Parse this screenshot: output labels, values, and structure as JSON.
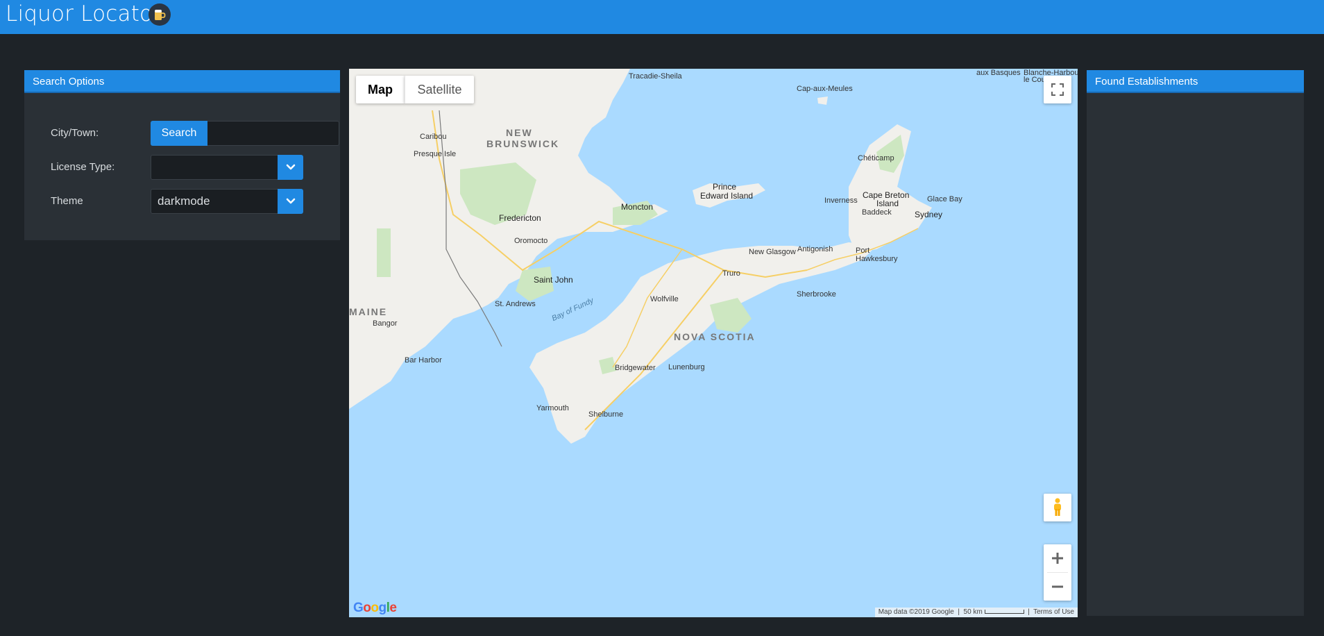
{
  "app": {
    "title": "Liquor Locator",
    "logo_icon": "beer-mug-icon",
    "accent_color": "#2089e2",
    "background_color": "#1e2328"
  },
  "search_options": {
    "header": "Search Options",
    "city_label": "City/Town:",
    "search_button": "Search",
    "city_value": "",
    "license_label": "License Type:",
    "license_value": "",
    "theme_label": "Theme",
    "theme_value": "darkmode"
  },
  "found": {
    "header": "Found Establishments",
    "items": []
  },
  "map": {
    "type_map": "Map",
    "type_satellite": "Satellite",
    "attribution_data": "Map data ©2019 Google",
    "scale": "50 km",
    "terms": "Terms of Use",
    "logo": "Google",
    "labels": {
      "new_brunswick": "NEW",
      "new_brunswick2": "BRUNSWICK",
      "nova_scotia": "NOVA SCOTIA",
      "maine": "MAINE",
      "pei": "Prince",
      "pei2": "Edward Island",
      "cape_breton": "Cape Breton",
      "cape_breton2": "Island",
      "fredericton": "Fredericton",
      "moncton": "Moncton",
      "saint_john": "Saint John",
      "sydney": "Sydney",
      "truro": "Truro",
      "antigonish": "Antigonish",
      "new_glasgow": "New Glasgow",
      "yarmouth": "Yarmouth",
      "bridgewater": "Bridgewater",
      "lunenburg": "Lunenburg",
      "shelburne": "Shelburne",
      "wolfville": "Wolfville",
      "sherbrooke": "Sherbrooke",
      "bangor": "Bangor",
      "bar_harbor": "Bar Harbor",
      "caribou": "Caribou",
      "presque_isle": "Presque Isle",
      "oromocto": "Oromocto",
      "st_andrews": "St. Andrews",
      "tracadie": "Tracadie-Sheila",
      "cap_aux_meules": "Cap-aux-Meules",
      "cheticamp": "Chéticamp",
      "inverness": "Inverness",
      "baddeck": "Baddeck",
      "glace_bay": "Glace Bay",
      "port_hawkesbury": "Port",
      "port_hawkesbury2": "Hawkesbury",
      "bay_of_fundy": "Bay of Fundy",
      "aux_basques": "aux Basques",
      "blanche": "Blanche-Harbour",
      "le_cou": "le Cou"
    }
  }
}
